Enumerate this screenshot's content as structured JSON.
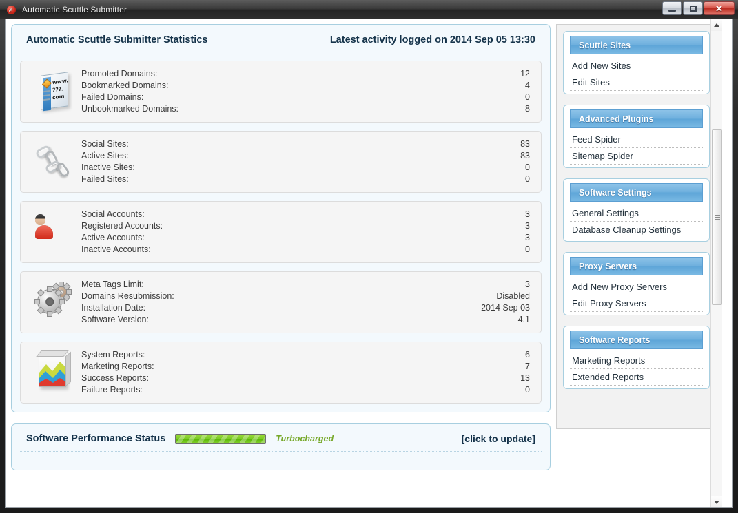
{
  "window": {
    "title": "Automatic Scuttle Submitter",
    "app_icon": "app-logo-icon",
    "minimize_label": "Minimize",
    "maximize_label": "Maximize",
    "close_label": "Close",
    "close_glyph": "✕"
  },
  "statistics": {
    "heading": "Automatic Scuttle Submitter Statistics",
    "latest_activity": "Latest activity logged on 2014 Sep 05 13:30",
    "groups": [
      {
        "icon": "website-card-icon",
        "icon_text_line1": "www.",
        "icon_text_line2": "???.",
        "icon_text_line3": "com",
        "rows": [
          {
            "label": "Promoted Domains:",
            "value": "12"
          },
          {
            "label": "Bookmarked Domains:",
            "value": "4"
          },
          {
            "label": "Failed Domains:",
            "value": "0"
          },
          {
            "label": "Unbookmarked Domains:",
            "value": "8"
          }
        ]
      },
      {
        "icon": "chain-link-icon",
        "rows": [
          {
            "label": "Social Sites:",
            "value": "83"
          },
          {
            "label": "Active Sites:",
            "value": "83"
          },
          {
            "label": "Inactive Sites:",
            "value": "0"
          },
          {
            "label": "Failed Sites:",
            "value": "0"
          }
        ]
      },
      {
        "icon": "users-group-icon",
        "rows": [
          {
            "label": "Social Accounts:",
            "value": "3"
          },
          {
            "label": "Registered Accounts:",
            "value": "3"
          },
          {
            "label": "Active Accounts:",
            "value": "3"
          },
          {
            "label": "Inactive Accounts:",
            "value": "0"
          }
        ]
      },
      {
        "icon": "gears-settings-icon",
        "rows": [
          {
            "label": "Meta Tags Limit:",
            "value": "3"
          },
          {
            "label": "Domains Resubmission:",
            "value": "Disabled"
          },
          {
            "label": "Installation Date:",
            "value": "2014 Sep 03"
          },
          {
            "label": "Software Version:",
            "value": "4.1"
          }
        ]
      },
      {
        "icon": "area-chart-icon",
        "rows": [
          {
            "label": "System Reports:",
            "value": "6"
          },
          {
            "label": "Marketing Reports:",
            "value": "7"
          },
          {
            "label": "Success Reports:",
            "value": "13"
          },
          {
            "label": "Failure Reports:",
            "value": "0"
          }
        ]
      }
    ]
  },
  "performance": {
    "title": "Software Performance Status",
    "progress_percent": 100,
    "status_label": "Turbocharged",
    "update_action": "[click to update]",
    "bar_color": "#7ccb24",
    "label_color": "#76a829"
  },
  "sidebar": {
    "boxes": [
      {
        "title": "Scuttle Sites",
        "links": [
          "Add New Sites",
          "Edit Sites"
        ]
      },
      {
        "title": "Advanced Plugins",
        "links": [
          "Feed Spider",
          "Sitemap Spider"
        ]
      },
      {
        "title": "Software Settings",
        "links": [
          "General Settings",
          "Database Cleanup Settings"
        ]
      },
      {
        "title": "Proxy Servers",
        "links": [
          "Add New Proxy Servers",
          "Edit Proxy Servers"
        ]
      },
      {
        "title": "Software Reports",
        "links": [
          "Marketing Reports",
          "Extended Reports"
        ]
      }
    ]
  },
  "scrollbar": {
    "up_arrow": "scroll-up-arrow",
    "down_arrow": "scroll-down-arrow"
  }
}
